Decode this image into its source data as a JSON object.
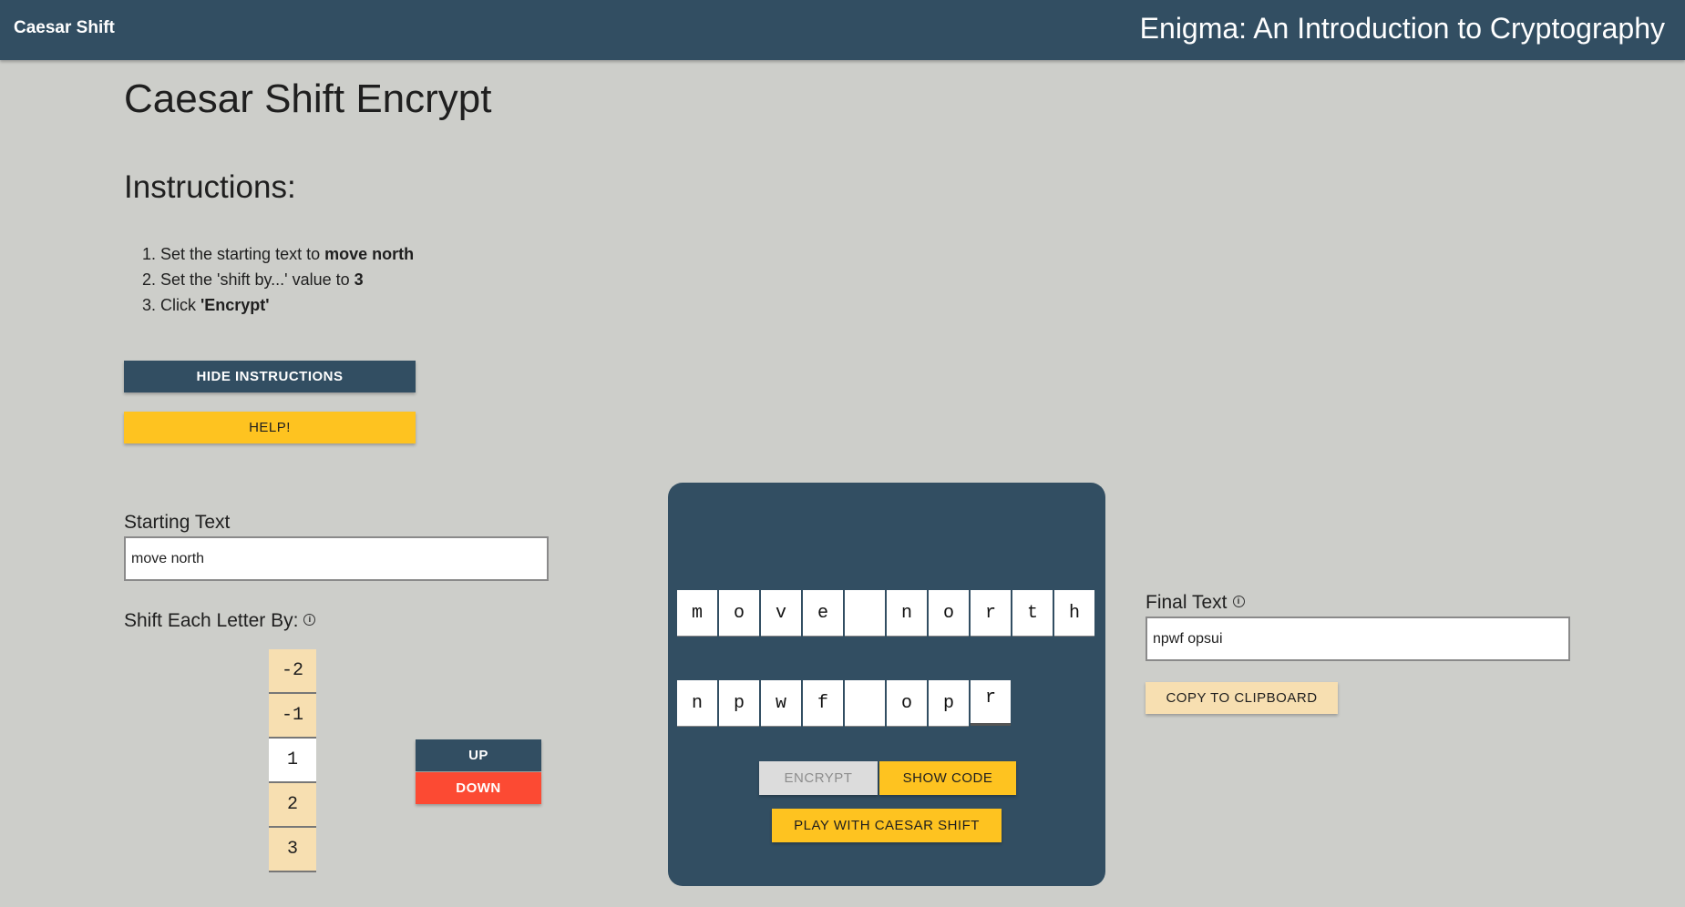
{
  "nav": {
    "brand": "Caesar Shift",
    "site_title": "Enigma: An Introduction to Cryptography"
  },
  "page": {
    "title": "Caesar Shift Encrypt",
    "instructions_title": "Instructions:",
    "steps": [
      {
        "num": "1.",
        "text": "Set the starting text to ",
        "bold": "move north"
      },
      {
        "num": "2.",
        "text": "Set the 'shift by...' value to ",
        "bold": "3"
      },
      {
        "num": "3.",
        "text": "Click ",
        "bold": "'Encrypt'"
      }
    ]
  },
  "buttons": {
    "hide_instructions": "HIDE INSTRUCTIONS",
    "help": "HELP!",
    "up": "UP",
    "down": "DOWN",
    "encrypt": "ENCRYPT",
    "show_code": "SHOW CODE",
    "play": "PLAY WITH CAESAR SHIFT",
    "copy": "COPY TO CLIPBOARD"
  },
  "starting_text": {
    "label": "Starting Text",
    "value": "move north"
  },
  "shift": {
    "label": "Shift Each Letter By:",
    "info_icon": "ⓘ",
    "values": [
      "-2",
      "-1",
      "1",
      "2",
      "3"
    ],
    "selected": "1"
  },
  "machine": {
    "input_letters": [
      "m",
      "o",
      "v",
      "e",
      "",
      "n",
      "o",
      "r",
      "t",
      "h"
    ],
    "output_letters": [
      "n",
      "p",
      "w",
      "f",
      "",
      "o",
      "p",
      "r"
    ]
  },
  "final_text": {
    "label": "Final Text",
    "info_icon": "ⓘ",
    "value": "npwf opsui"
  },
  "colors": {
    "navy": "#324e62",
    "yellow": "#fec320",
    "light_yellow": "#f7dfb1",
    "red": "#fc4a33",
    "background": "#cdceca"
  }
}
